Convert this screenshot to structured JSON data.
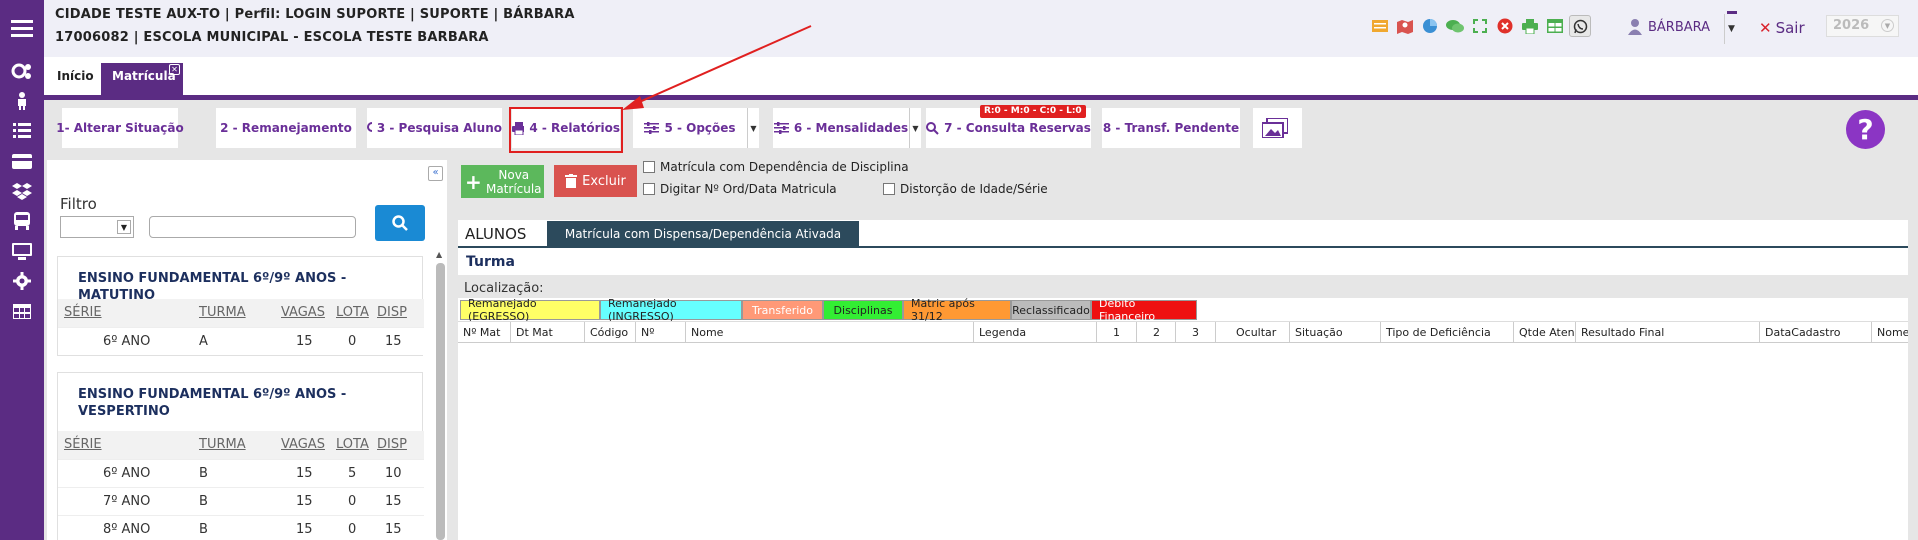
{
  "header": {
    "line1": "CIDADE TESTE AUX-TO | Perfil: LOGIN SUPORTE | SUPORTE | BÁRBARA",
    "line2": "17006082 | ESCOLA MUNICIPAL - ESCOLA TESTE BARBARA",
    "user_name": "BÁRBARA",
    "logout_label": "Sair",
    "year": "2026",
    "icons": [
      "list-icon",
      "map-icon",
      "pie-chart-icon",
      "chat-icon",
      "fullscreen-icon",
      "close-circle-icon",
      "printer-icon",
      "table-icon",
      "whatsapp-icon"
    ]
  },
  "sidebar": {
    "icons": [
      "menu-icon",
      "settings-icon",
      "person-icon",
      "list-icon",
      "card-icon",
      "dropbox-icon",
      "bus-icon",
      "monitor-icon",
      "gear-icon",
      "grid-icon"
    ],
    "color": "#5b2c83"
  },
  "tabs": {
    "home": "Início",
    "active": "Matrícula"
  },
  "toolbar": {
    "btn1": "1- Alterar Situação",
    "btn2": "2 - Remanejamento",
    "btn3": "3 - Pesquisa Aluno",
    "btn4": "4 - Relatórios",
    "btn5": "5 - Opções",
    "btn6": "6 - Mensalidades",
    "btn7": "7 - Consulta Reservas",
    "btn8": "8 - Transf. Pendente",
    "badge": "R:0 - M:0 - C:0 - L:0",
    "help": "?"
  },
  "filter": {
    "label": "Filtro",
    "groups": [
      {
        "title": "ENSINO FUNDAMENTAL 6º/9º ANOS - MATUTINO",
        "headers": [
          "SÉRIE",
          "TURMA",
          "VAGAS",
          "LOTA",
          "DISP"
        ],
        "rows": [
          [
            "6º ANO",
            "A",
            "15",
            "0",
            "15"
          ]
        ]
      },
      {
        "title": "ENSINO FUNDAMENTAL 6º/9º ANOS - VESPERTINO",
        "headers": [
          "SÉRIE",
          "TURMA",
          "VAGAS",
          "LOTA",
          "DISP"
        ],
        "rows": [
          [
            "6º ANO",
            "B",
            "15",
            "5",
            "10"
          ],
          [
            "7º ANO",
            "B",
            "15",
            "0",
            "15"
          ],
          [
            "8º ANO",
            "B",
            "15",
            "0",
            "15"
          ]
        ]
      }
    ]
  },
  "actions": {
    "nova": "Nova\nMatrícula",
    "excluir": "Excluir",
    "chk_dependencia": "Matrícula com Dependência de Disciplina",
    "chk_digitar": "Digitar Nº Ord/Data Matricula",
    "chk_distorcao": "Distorção de Idade/Série"
  },
  "alunos": {
    "tab_label": "ALUNOS",
    "tab_dispensa": "Matrícula com Dispensa/Dependência Ativada",
    "turma": "Turma",
    "localizacao": "Localização:",
    "legend": [
      {
        "label": "Remanejado (EGRESSO)",
        "color": "#ffff66"
      },
      {
        "label": "Remanejado (INGRESSO)",
        "color": "#66ffff"
      },
      {
        "label": "Transferido",
        "color": "#ff9977"
      },
      {
        "label": "Disciplinas",
        "color": "#33ee33"
      },
      {
        "label": "Matric após 31/12",
        "color": "#ff9933"
      },
      {
        "label": "Reclassificado",
        "color": "#bbbbbb"
      },
      {
        "label": "Debito Financeiro",
        "color": "#ee1111"
      }
    ],
    "columns": [
      "Nº Mat",
      "Dt Mat",
      "Código",
      "Nº",
      "Nome",
      "Legenda",
      "1",
      "2",
      "3",
      "Ocultar",
      "Situação",
      "Tipo de Deficiência",
      "Qtde Atendimento",
      "Resultado Final",
      "DataCadastro",
      "Nome"
    ]
  }
}
